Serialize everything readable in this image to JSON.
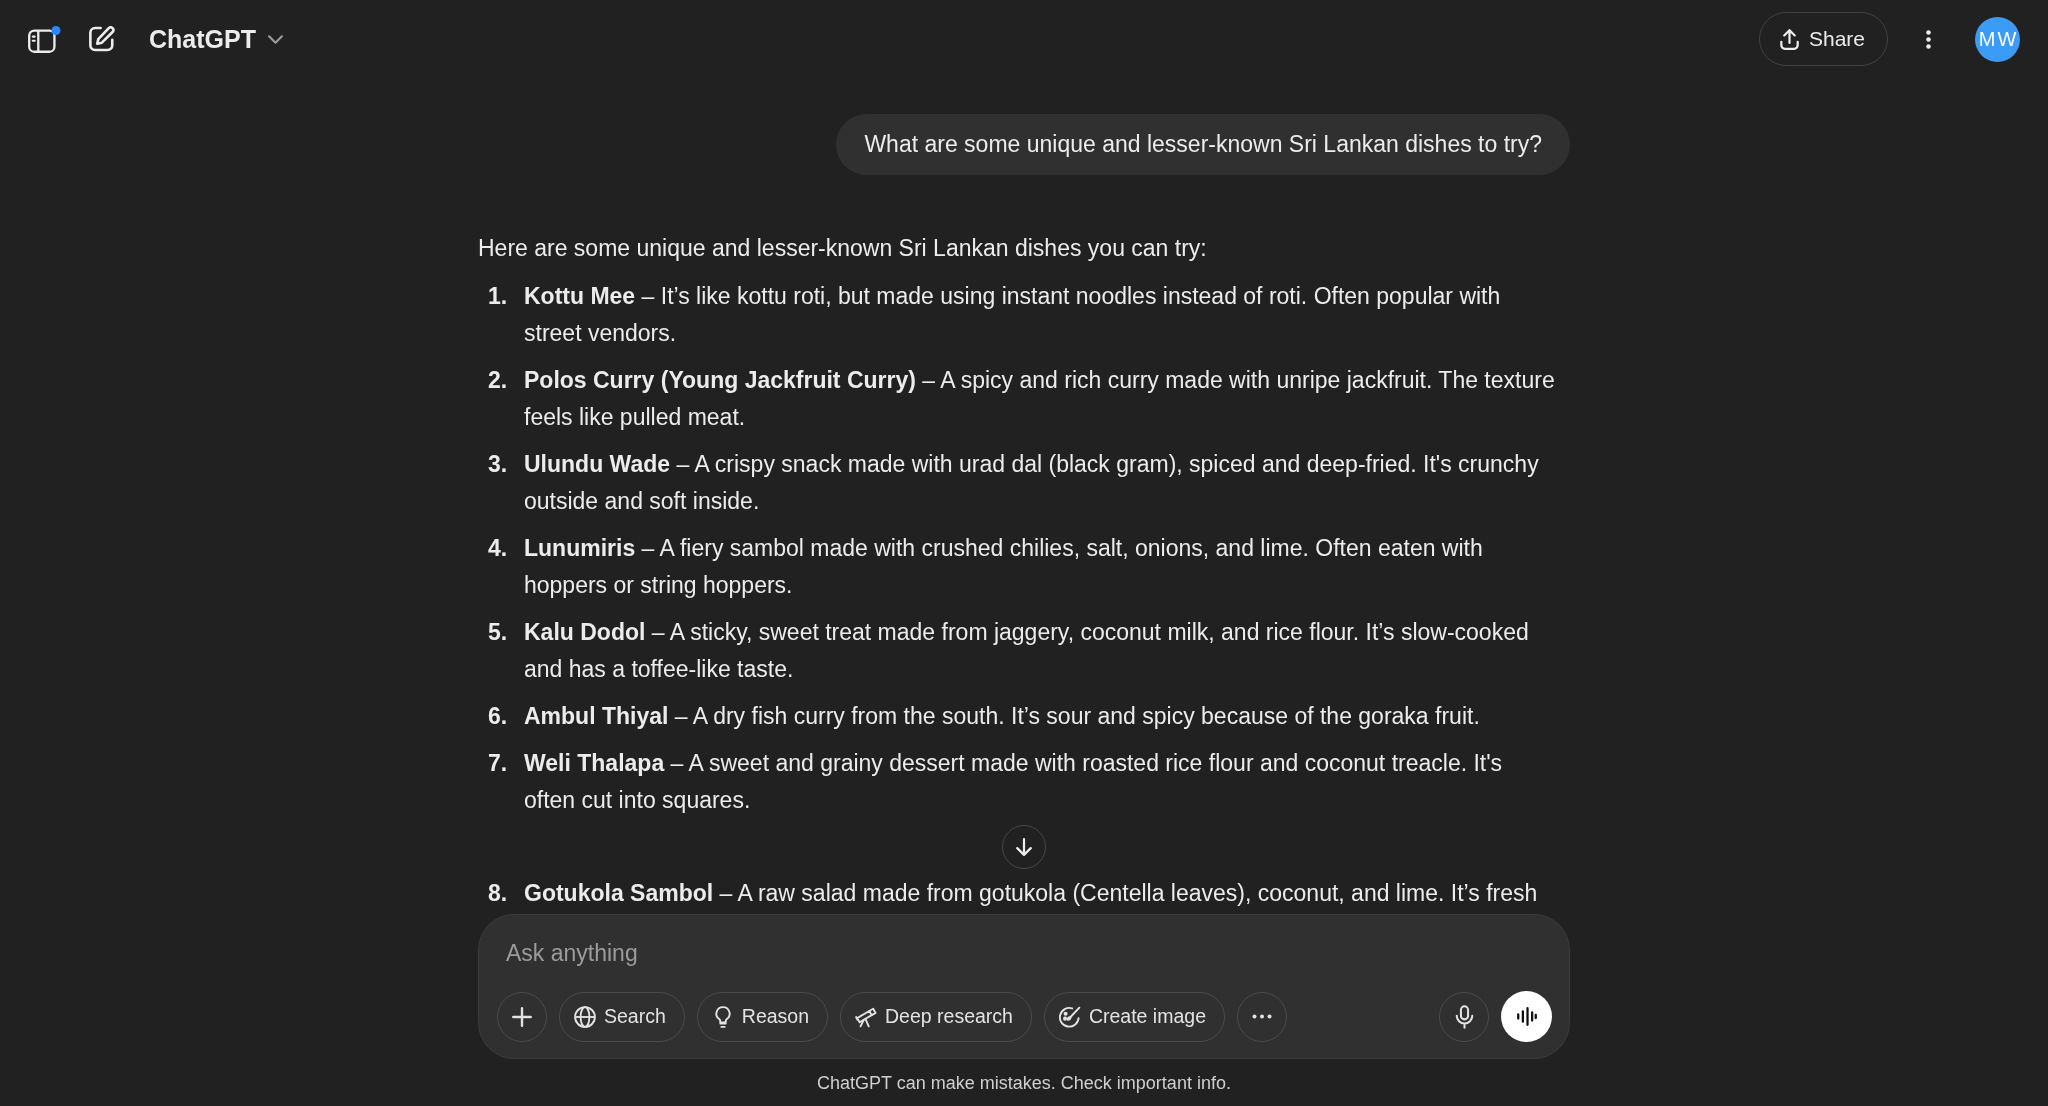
{
  "header": {
    "title": "ChatGPT",
    "share_label": "Share",
    "avatar_initials": "MW"
  },
  "conversation": {
    "user_message": "What are some unique and lesser-known Sri Lankan dishes to try?",
    "response_intro": "Here are some unique and lesser-known Sri Lankan dishes you can try:",
    "dishes": [
      {
        "number": "1.",
        "text": "**Kottu Mee** – It’s like kottu roti, but made using instant noodles instead of roti. Often popular with street vendors."
      },
      {
        "number": "2.",
        "text": "**Polos Curry (Young Jackfruit Curry)** – A spicy and rich curry made with unripe jackfruit. The texture feels like pulled meat."
      },
      {
        "number": "3.",
        "text": "**Ulundu Wade** – A crispy snack made with urad dal (black gram), spiced and deep-fried. It's crunchy outside and soft inside."
      },
      {
        "number": "4.",
        "text": "**Lunumiris** – A fiery sambol made with crushed chilies, salt, onions, and lime. Often eaten with hoppers or string hoppers."
      },
      {
        "number": "5.",
        "text": "**Kalu Dodol** – A sticky, sweet treat made from jaggery, coconut milk, and rice flour. It’s slow-cooked and has a toffee-like taste."
      },
      {
        "number": "6.",
        "text": "**Ambul Thiyal** – A dry fish curry from the south. It’s sour and spicy because of the goraka fruit."
      },
      {
        "number": "7.",
        "text": "**Weli Thalapa** – A sweet and grainy dessert made with roasted rice flour and coconut treacle. It's often cut into squares."
      },
      {
        "number": "8.",
        "text": "**Gotukola Sambol** – A raw salad made from gotukola (Centella leaves), coconut, and lime. It’s fresh"
      }
    ]
  },
  "composer": {
    "placeholder": "Ask anything",
    "tools": [
      "Search",
      "Reason",
      "Deep research",
      "Create image"
    ]
  },
  "footer": {
    "disclaimer": "ChatGPT can make mistakes. Check important info."
  }
}
